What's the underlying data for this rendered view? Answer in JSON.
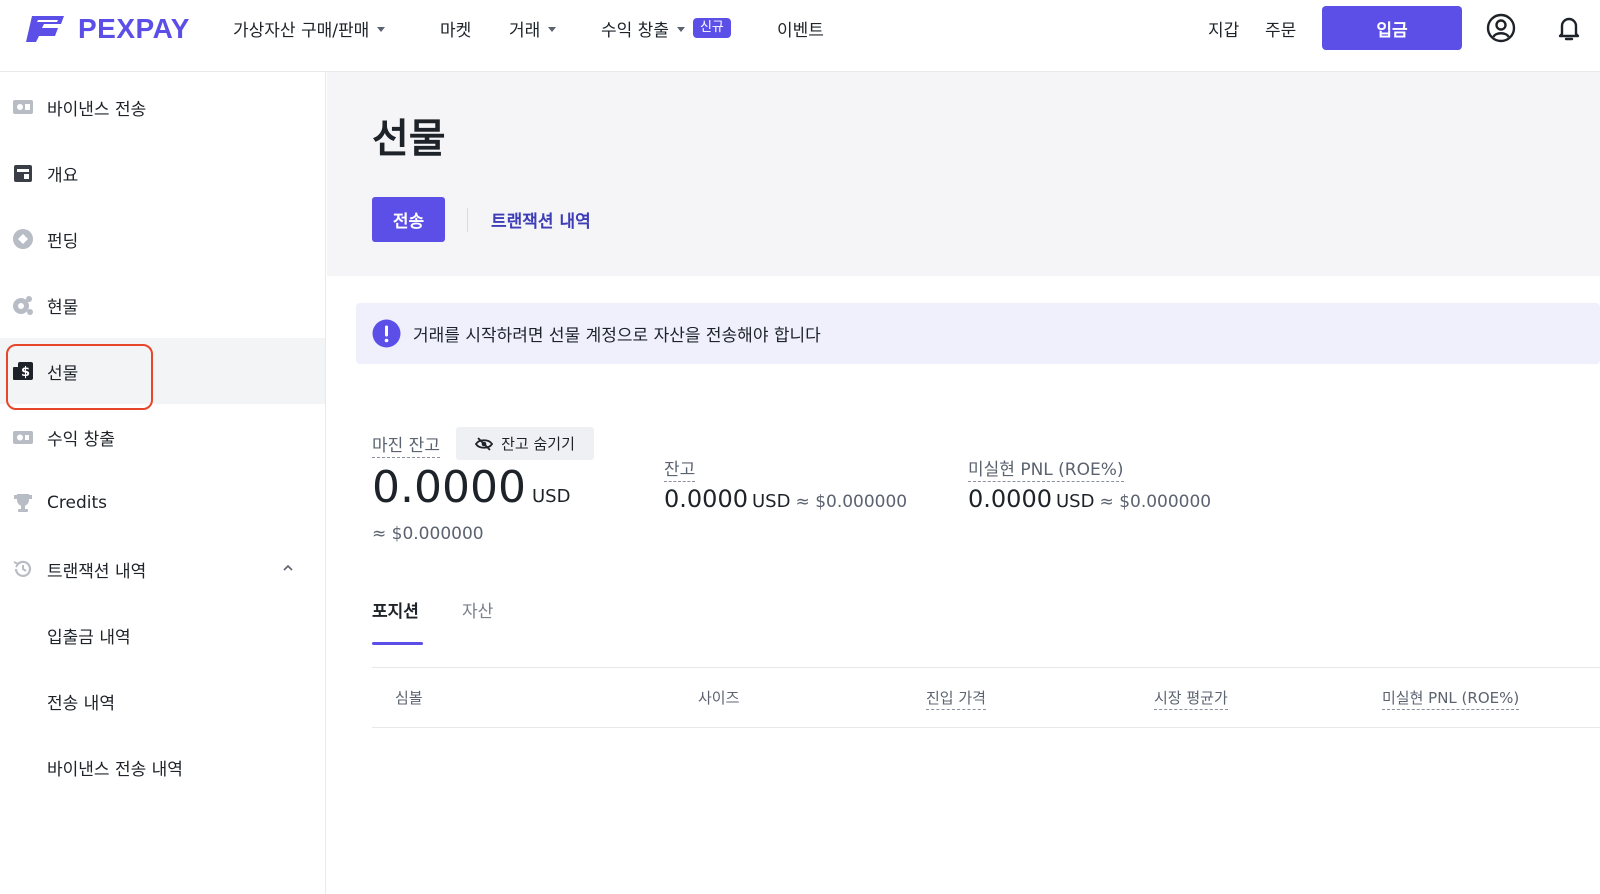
{
  "header": {
    "logo_text": "PEXPAY",
    "nav": [
      {
        "label": "가상자산 구매/판매",
        "has_caret": true
      },
      {
        "label": "마켓"
      },
      {
        "label": "거래",
        "has_caret": true
      },
      {
        "label": "수익 창출",
        "has_caret": true,
        "badge": "신규"
      },
      {
        "label": "이벤트"
      }
    ],
    "links": {
      "wallet": "지갑",
      "orders": "주문"
    },
    "deposit_label": "입금",
    "icons": [
      "user-icon",
      "bell-icon"
    ]
  },
  "sidebar": {
    "items": [
      {
        "label": "바이낸스 전송",
        "icon": "binance-transfer-icon"
      },
      {
        "label": "개요",
        "icon": "overview-icon"
      },
      {
        "label": "펀딩",
        "icon": "funding-icon"
      },
      {
        "label": "현물",
        "icon": "spot-icon"
      },
      {
        "label": "선물",
        "icon": "futures-icon",
        "active": true
      },
      {
        "label": "수익 창출",
        "icon": "earn-icon"
      },
      {
        "label": "Credits",
        "icon": "trophy-icon"
      },
      {
        "label": "트랜잭션 내역",
        "icon": "history-icon",
        "expanded": true
      },
      {
        "label": "입출금 내역"
      },
      {
        "label": "전송 내역"
      },
      {
        "label": "바이낸스 전송 내역"
      }
    ]
  },
  "main": {
    "title": "선물",
    "tabs": {
      "transfer": "전송",
      "history": "트랜잭션 내역"
    },
    "notice": "거래를 시작하려면 선물 계정으로 자산을 전송해야 합니다",
    "margin_balance": {
      "label": "마진 잔고",
      "hide_label": "잔고 숨기기",
      "value": "0.0000",
      "unit": "USD",
      "approx": "≈ $0.000000"
    },
    "balance": {
      "label": "잔고",
      "value": "0.0000",
      "unit": "USD",
      "approx": "≈ $0.000000"
    },
    "unrealized_pnl": {
      "label": "미실현 PNL (ROE%)",
      "value": "0.0000",
      "unit": "USD",
      "approx": "≈ $0.000000"
    },
    "sub_tabs": {
      "positions": "포지션",
      "assets": "자산"
    },
    "table_headers": [
      "심볼",
      "사이즈",
      "진입 가격",
      "시장 평균가",
      "미실현 PNL (ROE%)"
    ]
  },
  "colors": {
    "accent": "#5b4fe8",
    "highlight_outline": "#e8462a"
  }
}
